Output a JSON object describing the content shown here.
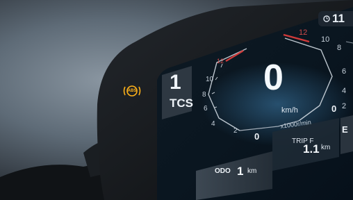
{
  "indicators": {
    "abs_label": "ABS",
    "abs_color": "#ffb21a"
  },
  "clock": {
    "value": "11"
  },
  "tcs": {
    "level": "1",
    "label": "TCS"
  },
  "speed": {
    "value": "0",
    "unit": "km/h"
  },
  "tacho": {
    "unit": "x1000r/min",
    "left_scale": [
      "12",
      "10",
      "8",
      "6",
      "4",
      "2",
      "0"
    ],
    "right_scale": [
      "12",
      "10",
      "8",
      "6",
      "4",
      "2",
      "0"
    ]
  },
  "trip": {
    "label": "TRIP F",
    "value": "1.1",
    "unit": "km"
  },
  "odo": {
    "label": "ODO",
    "value": "1",
    "unit": "km"
  },
  "fuel": {
    "label": "E"
  }
}
